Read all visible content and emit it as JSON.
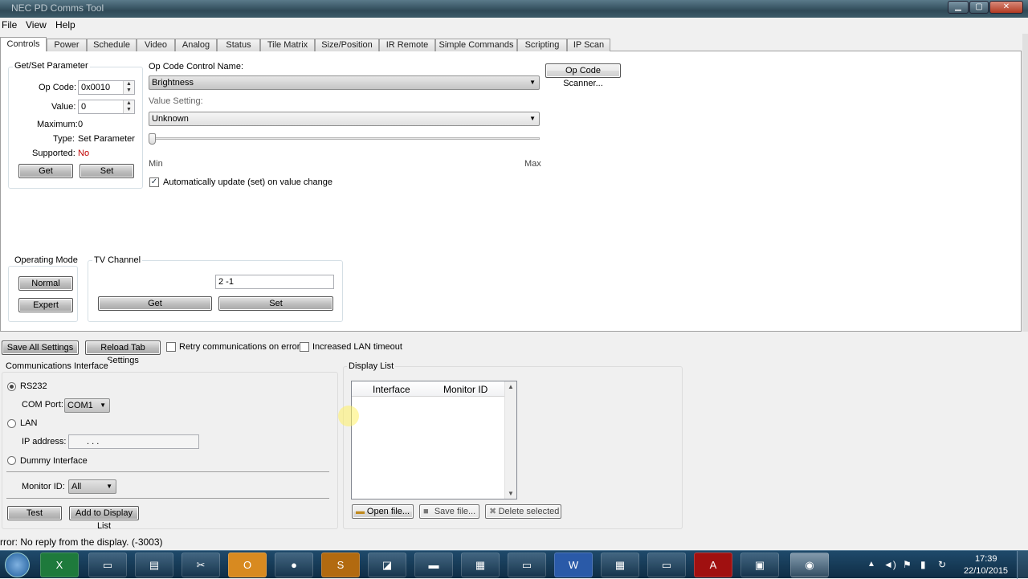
{
  "window": {
    "title": "NEC PD Comms Tool"
  },
  "menu": [
    "File",
    "View",
    "Help"
  ],
  "tabs": [
    "Controls",
    "Power",
    "Schedule",
    "Video",
    "Analog",
    "Status",
    "Tile Matrix",
    "Size/Position",
    "IR Remote",
    "Simple Commands",
    "Scripting",
    "IP Scan"
  ],
  "getset": {
    "legend": "Get/Set Parameter",
    "opcode_label": "Op Code:",
    "opcode_value": "0x0010",
    "value_label": "Value:",
    "value_value": "0",
    "maximum_label": "Maximum:",
    "maximum_value": "0",
    "type_label": "Type:",
    "type_value": "Set Parameter",
    "supported_label": "Supported:",
    "supported_value": "No",
    "get_label": "Get",
    "set_label": "Set"
  },
  "opcontrol": {
    "name_label": "Op Code Control Name:",
    "name_value": "Brightness",
    "value_setting_label": "Value Setting:",
    "value_setting_value": "Unknown",
    "min_label": "Min",
    "max_label": "Max",
    "slider_level": 0,
    "auto_update_label": "Automatically update (set) on value change",
    "auto_update_checked": true,
    "scanner_label": "Op Code Scanner..."
  },
  "operating_mode": {
    "legend": "Operating Mode",
    "normal_label": "Normal",
    "expert_label": "Expert"
  },
  "tv_channel": {
    "legend": "TV Channel",
    "value": "2  -1",
    "get_label": "Get",
    "set_label": "Set"
  },
  "bottom_toolbar": {
    "save_all_label": "Save All Settings",
    "reload_label": "Reload Tab Settings",
    "retry_label": "Retry communications on error",
    "lan_timeout_label": "Increased LAN timeout"
  },
  "comm": {
    "legend": "Communications Interface",
    "rs232_label": "RS232",
    "com_port_label": "COM Port:",
    "com_port_value": "COM1",
    "lan_label": "LAN",
    "ip_label": "IP address:",
    "ip_value": ". . .",
    "dummy_label": "Dummy Interface",
    "monitor_id_label": "Monitor ID:",
    "monitor_id_value": "All",
    "test_label": "Test",
    "add_label": "Add to Display List"
  },
  "display_list": {
    "legend": "Display List",
    "columns": [
      "Interface",
      "Monitor ID"
    ],
    "open_label": "Open file...",
    "save_label": "Save file...",
    "delete_label": "Delete selected"
  },
  "status": {
    "text": "rror: No reply from the display. (-3003)"
  },
  "taskbar": {
    "time": "17:39",
    "date": "22/10/2015"
  }
}
